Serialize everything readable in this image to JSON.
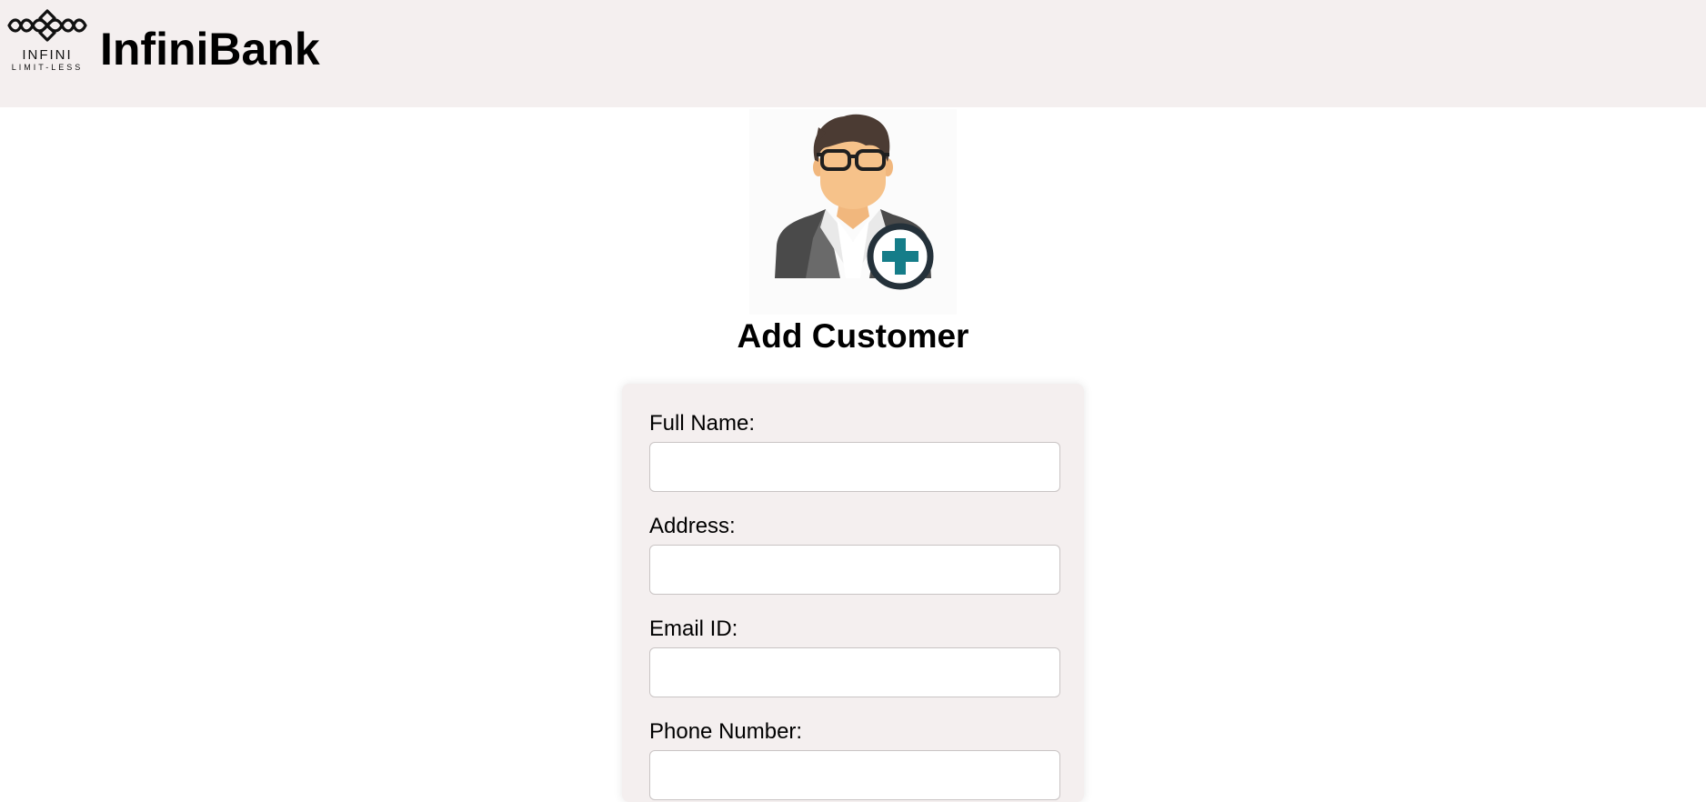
{
  "header": {
    "logo_text": "INFINI",
    "logo_tagline": "LIMIT-LESS",
    "brand": "InfiniBank",
    "background": "#f4efef"
  },
  "main": {
    "avatar_icon": "add-customer-icon",
    "title": "Add Customer"
  },
  "form": {
    "fields": [
      {
        "label": "Full Name:",
        "value": ""
      },
      {
        "label": "Address:",
        "value": ""
      },
      {
        "label": "Email ID:",
        "value": ""
      },
      {
        "label": "Phone Number:",
        "value": ""
      }
    ],
    "card_background": "#f4efef"
  }
}
